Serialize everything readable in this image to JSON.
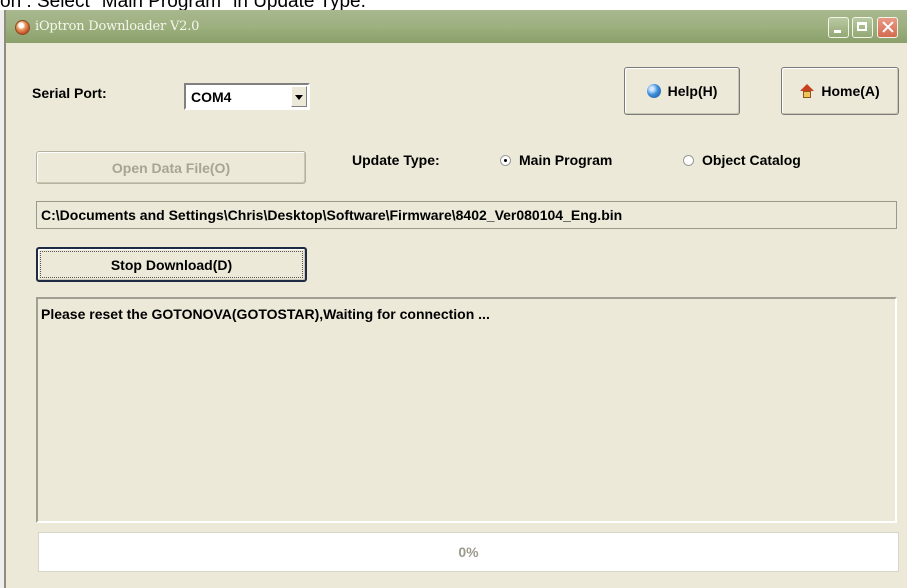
{
  "caption": "on : Select \"Main Program\" in Update Type.",
  "window": {
    "title": "iOptron Downloader V2.0"
  },
  "serial_port": {
    "label": "Serial Port:",
    "value": "COM4"
  },
  "buttons": {
    "help": "Help(H)",
    "home": "Home(A)",
    "open_data_file": "Open Data File(O)",
    "stop_download": "Stop Download(D)"
  },
  "update_type": {
    "label": "Update Type:",
    "options": [
      "Main Program",
      "Object Catalog"
    ],
    "selected": "Main Program"
  },
  "file_path": "C:\\Documents and Settings\\Chris\\Desktop\\Software\\Firmware\\8402_Ver080104_Eng.bin",
  "log_text": "Please reset the GOTONOVA(GOTOSTAR),Waiting for connection ...",
  "progress": {
    "value": 0,
    "label": "0%"
  },
  "icons": {
    "app": "app-icon",
    "help": "globe-icon",
    "home": "house-icon"
  }
}
